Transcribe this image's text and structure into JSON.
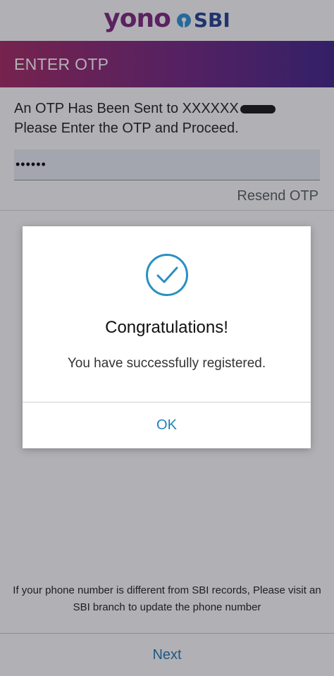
{
  "header": {
    "brand_yono": "yono",
    "brand_sbi": "SBI",
    "logo_icon": "sbi-logo-icon"
  },
  "title_bar": {
    "title": "ENTER OTP"
  },
  "otp": {
    "message_line1": "An OTP Has Been Sent to XXXXXX",
    "message_line2": "Please Enter the OTP and Proceed.",
    "input_value": "••••••",
    "resend_label": "Resend OTP"
  },
  "disclaimer": {
    "line1": "If your phone number is different from SBI records, Please visit an",
    "line2": "SBI branch to update the phone number"
  },
  "footer": {
    "next_label": "Next"
  },
  "dialog": {
    "icon": "check-circle-icon",
    "title": "Congratulations!",
    "message": "You have successfully registered.",
    "ok_label": "OK"
  },
  "colors": {
    "brand_purple": "#7a1f7a",
    "brand_blue": "#1d3c8f",
    "gradient_start": "#a3215e",
    "gradient_end": "#3b1d86",
    "link_blue": "#1f82b8",
    "check_blue": "#2a8fc3"
  }
}
